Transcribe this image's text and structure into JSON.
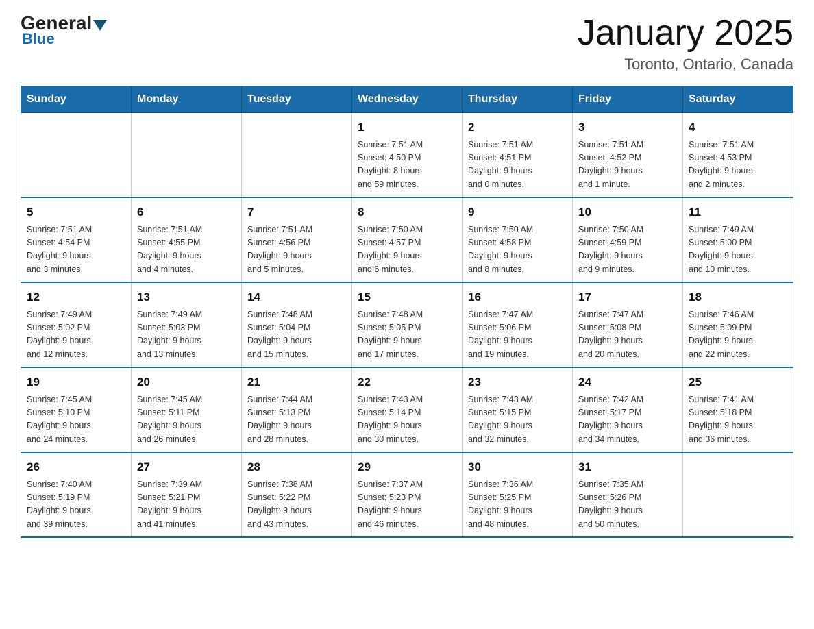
{
  "header": {
    "logo_general": "General",
    "logo_blue": "Blue",
    "title": "January 2025",
    "subtitle": "Toronto, Ontario, Canada"
  },
  "calendar": {
    "weekdays": [
      "Sunday",
      "Monday",
      "Tuesday",
      "Wednesday",
      "Thursday",
      "Friday",
      "Saturday"
    ],
    "weeks": [
      [
        {
          "day": "",
          "info": ""
        },
        {
          "day": "",
          "info": ""
        },
        {
          "day": "",
          "info": ""
        },
        {
          "day": "1",
          "info": "Sunrise: 7:51 AM\nSunset: 4:50 PM\nDaylight: 8 hours\nand 59 minutes."
        },
        {
          "day": "2",
          "info": "Sunrise: 7:51 AM\nSunset: 4:51 PM\nDaylight: 9 hours\nand 0 minutes."
        },
        {
          "day": "3",
          "info": "Sunrise: 7:51 AM\nSunset: 4:52 PM\nDaylight: 9 hours\nand 1 minute."
        },
        {
          "day": "4",
          "info": "Sunrise: 7:51 AM\nSunset: 4:53 PM\nDaylight: 9 hours\nand 2 minutes."
        }
      ],
      [
        {
          "day": "5",
          "info": "Sunrise: 7:51 AM\nSunset: 4:54 PM\nDaylight: 9 hours\nand 3 minutes."
        },
        {
          "day": "6",
          "info": "Sunrise: 7:51 AM\nSunset: 4:55 PM\nDaylight: 9 hours\nand 4 minutes."
        },
        {
          "day": "7",
          "info": "Sunrise: 7:51 AM\nSunset: 4:56 PM\nDaylight: 9 hours\nand 5 minutes."
        },
        {
          "day": "8",
          "info": "Sunrise: 7:50 AM\nSunset: 4:57 PM\nDaylight: 9 hours\nand 6 minutes."
        },
        {
          "day": "9",
          "info": "Sunrise: 7:50 AM\nSunset: 4:58 PM\nDaylight: 9 hours\nand 8 minutes."
        },
        {
          "day": "10",
          "info": "Sunrise: 7:50 AM\nSunset: 4:59 PM\nDaylight: 9 hours\nand 9 minutes."
        },
        {
          "day": "11",
          "info": "Sunrise: 7:49 AM\nSunset: 5:00 PM\nDaylight: 9 hours\nand 10 minutes."
        }
      ],
      [
        {
          "day": "12",
          "info": "Sunrise: 7:49 AM\nSunset: 5:02 PM\nDaylight: 9 hours\nand 12 minutes."
        },
        {
          "day": "13",
          "info": "Sunrise: 7:49 AM\nSunset: 5:03 PM\nDaylight: 9 hours\nand 13 minutes."
        },
        {
          "day": "14",
          "info": "Sunrise: 7:48 AM\nSunset: 5:04 PM\nDaylight: 9 hours\nand 15 minutes."
        },
        {
          "day": "15",
          "info": "Sunrise: 7:48 AM\nSunset: 5:05 PM\nDaylight: 9 hours\nand 17 minutes."
        },
        {
          "day": "16",
          "info": "Sunrise: 7:47 AM\nSunset: 5:06 PM\nDaylight: 9 hours\nand 19 minutes."
        },
        {
          "day": "17",
          "info": "Sunrise: 7:47 AM\nSunset: 5:08 PM\nDaylight: 9 hours\nand 20 minutes."
        },
        {
          "day": "18",
          "info": "Sunrise: 7:46 AM\nSunset: 5:09 PM\nDaylight: 9 hours\nand 22 minutes."
        }
      ],
      [
        {
          "day": "19",
          "info": "Sunrise: 7:45 AM\nSunset: 5:10 PM\nDaylight: 9 hours\nand 24 minutes."
        },
        {
          "day": "20",
          "info": "Sunrise: 7:45 AM\nSunset: 5:11 PM\nDaylight: 9 hours\nand 26 minutes."
        },
        {
          "day": "21",
          "info": "Sunrise: 7:44 AM\nSunset: 5:13 PM\nDaylight: 9 hours\nand 28 minutes."
        },
        {
          "day": "22",
          "info": "Sunrise: 7:43 AM\nSunset: 5:14 PM\nDaylight: 9 hours\nand 30 minutes."
        },
        {
          "day": "23",
          "info": "Sunrise: 7:43 AM\nSunset: 5:15 PM\nDaylight: 9 hours\nand 32 minutes."
        },
        {
          "day": "24",
          "info": "Sunrise: 7:42 AM\nSunset: 5:17 PM\nDaylight: 9 hours\nand 34 minutes."
        },
        {
          "day": "25",
          "info": "Sunrise: 7:41 AM\nSunset: 5:18 PM\nDaylight: 9 hours\nand 36 minutes."
        }
      ],
      [
        {
          "day": "26",
          "info": "Sunrise: 7:40 AM\nSunset: 5:19 PM\nDaylight: 9 hours\nand 39 minutes."
        },
        {
          "day": "27",
          "info": "Sunrise: 7:39 AM\nSunset: 5:21 PM\nDaylight: 9 hours\nand 41 minutes."
        },
        {
          "day": "28",
          "info": "Sunrise: 7:38 AM\nSunset: 5:22 PM\nDaylight: 9 hours\nand 43 minutes."
        },
        {
          "day": "29",
          "info": "Sunrise: 7:37 AM\nSunset: 5:23 PM\nDaylight: 9 hours\nand 46 minutes."
        },
        {
          "day": "30",
          "info": "Sunrise: 7:36 AM\nSunset: 5:25 PM\nDaylight: 9 hours\nand 48 minutes."
        },
        {
          "day": "31",
          "info": "Sunrise: 7:35 AM\nSunset: 5:26 PM\nDaylight: 9 hours\nand 50 minutes."
        },
        {
          "day": "",
          "info": ""
        }
      ]
    ]
  }
}
